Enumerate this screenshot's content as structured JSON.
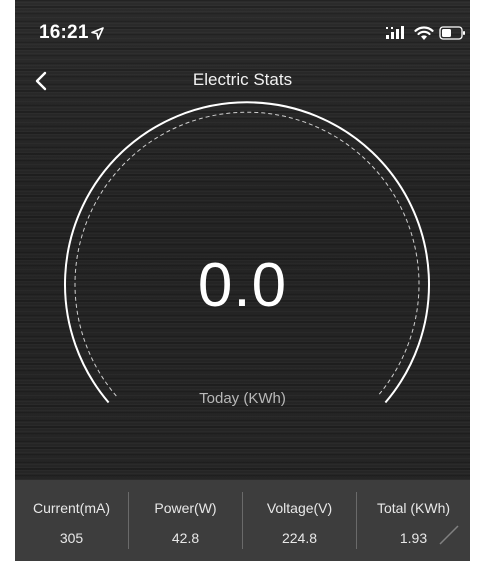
{
  "status_bar": {
    "time": "16:21",
    "location_icon": "location-arrow-icon",
    "signal_icon": "cellular-signal-icon",
    "wifi_icon": "wifi-icon",
    "battery_icon": "battery-icon"
  },
  "nav": {
    "back_icon": "chevron-left-icon",
    "title": "Electric Stats"
  },
  "gauge": {
    "value": "0.0",
    "unit_label": "Today (KWh)"
  },
  "stats": [
    {
      "label": "Current(mA)",
      "value": "305"
    },
    {
      "label": "Power(W)",
      "value": "42.8"
    },
    {
      "label": "Voltage(V)",
      "value": "224.8"
    },
    {
      "label": "Total (KWh)",
      "value": "1.93"
    }
  ],
  "colors": {
    "background": "#262626",
    "stats_bar": "#3d3d3d",
    "text": "#ffffff",
    "muted_text": "#b8b8b8"
  }
}
